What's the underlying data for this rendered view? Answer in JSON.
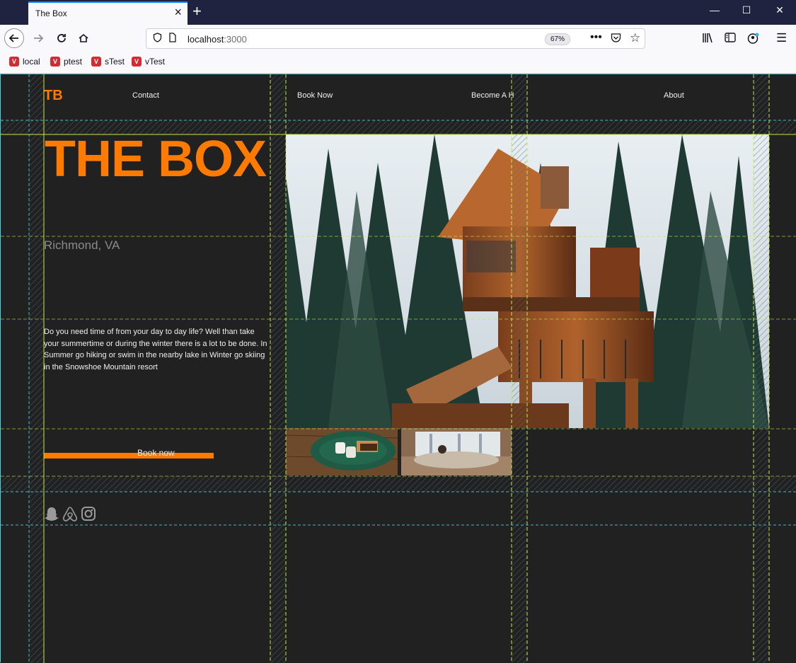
{
  "browser": {
    "tab_title": "The Box",
    "url_host": "localhost",
    "url_port": ":3000",
    "zoom": "67%",
    "bookmarks": [
      {
        "label": "local"
      },
      {
        "label": "ptest"
      },
      {
        "label": "sTest"
      },
      {
        "label": "vTest"
      }
    ]
  },
  "page": {
    "brand": "TB",
    "nav": {
      "contact": "Contact",
      "book_now": "Book Now",
      "become_host": "Become A H",
      "about": "About"
    },
    "hero_title": "THE BOX",
    "location": "Richmond, VA",
    "blurb": "Do you need time of from your day to day life? Well than take your summertime or during the winter there is a lot to be done. In Summer go hiking or swim in the nearby lake in Winter go skiing in the Snowshoe Mountain resort",
    "book_button": "Book now",
    "socials": [
      "snapchat-icon",
      "airbnb-icon",
      "instagram-icon"
    ]
  },
  "colors": {
    "accent": "#ff7a00",
    "background": "#212121",
    "text": "#f0f0f0",
    "muted": "#8a8a8a"
  }
}
